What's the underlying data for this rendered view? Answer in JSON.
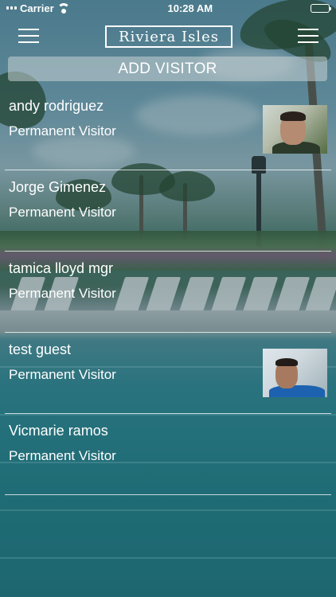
{
  "status_bar": {
    "carrier": "Carrier",
    "time": "10:28 AM"
  },
  "header": {
    "logo_text": "Riviera Isles",
    "left_icon": "hamburger-menu-icon",
    "right_icon": "hamburger-menu-icon"
  },
  "add_visitor_label": "ADD VISITOR",
  "visitors": [
    {
      "name": "andy rodriguez",
      "type": "Permanent Visitor",
      "has_photo": true
    },
    {
      "name": "Jorge Gimenez",
      "type": "Permanent Visitor",
      "has_photo": false
    },
    {
      "name": "tamica lloyd mgr",
      "type": "Permanent Visitor",
      "has_photo": false
    },
    {
      "name": "test guest",
      "type": "Permanent Visitor",
      "has_photo": true
    },
    {
      "name": "Vicmarie ramos",
      "type": "Permanent Visitor",
      "has_photo": false
    }
  ],
  "colors": {
    "text": "#ffffff",
    "add_button_bg": "#c8d2d4",
    "pool": "#2f8590"
  }
}
